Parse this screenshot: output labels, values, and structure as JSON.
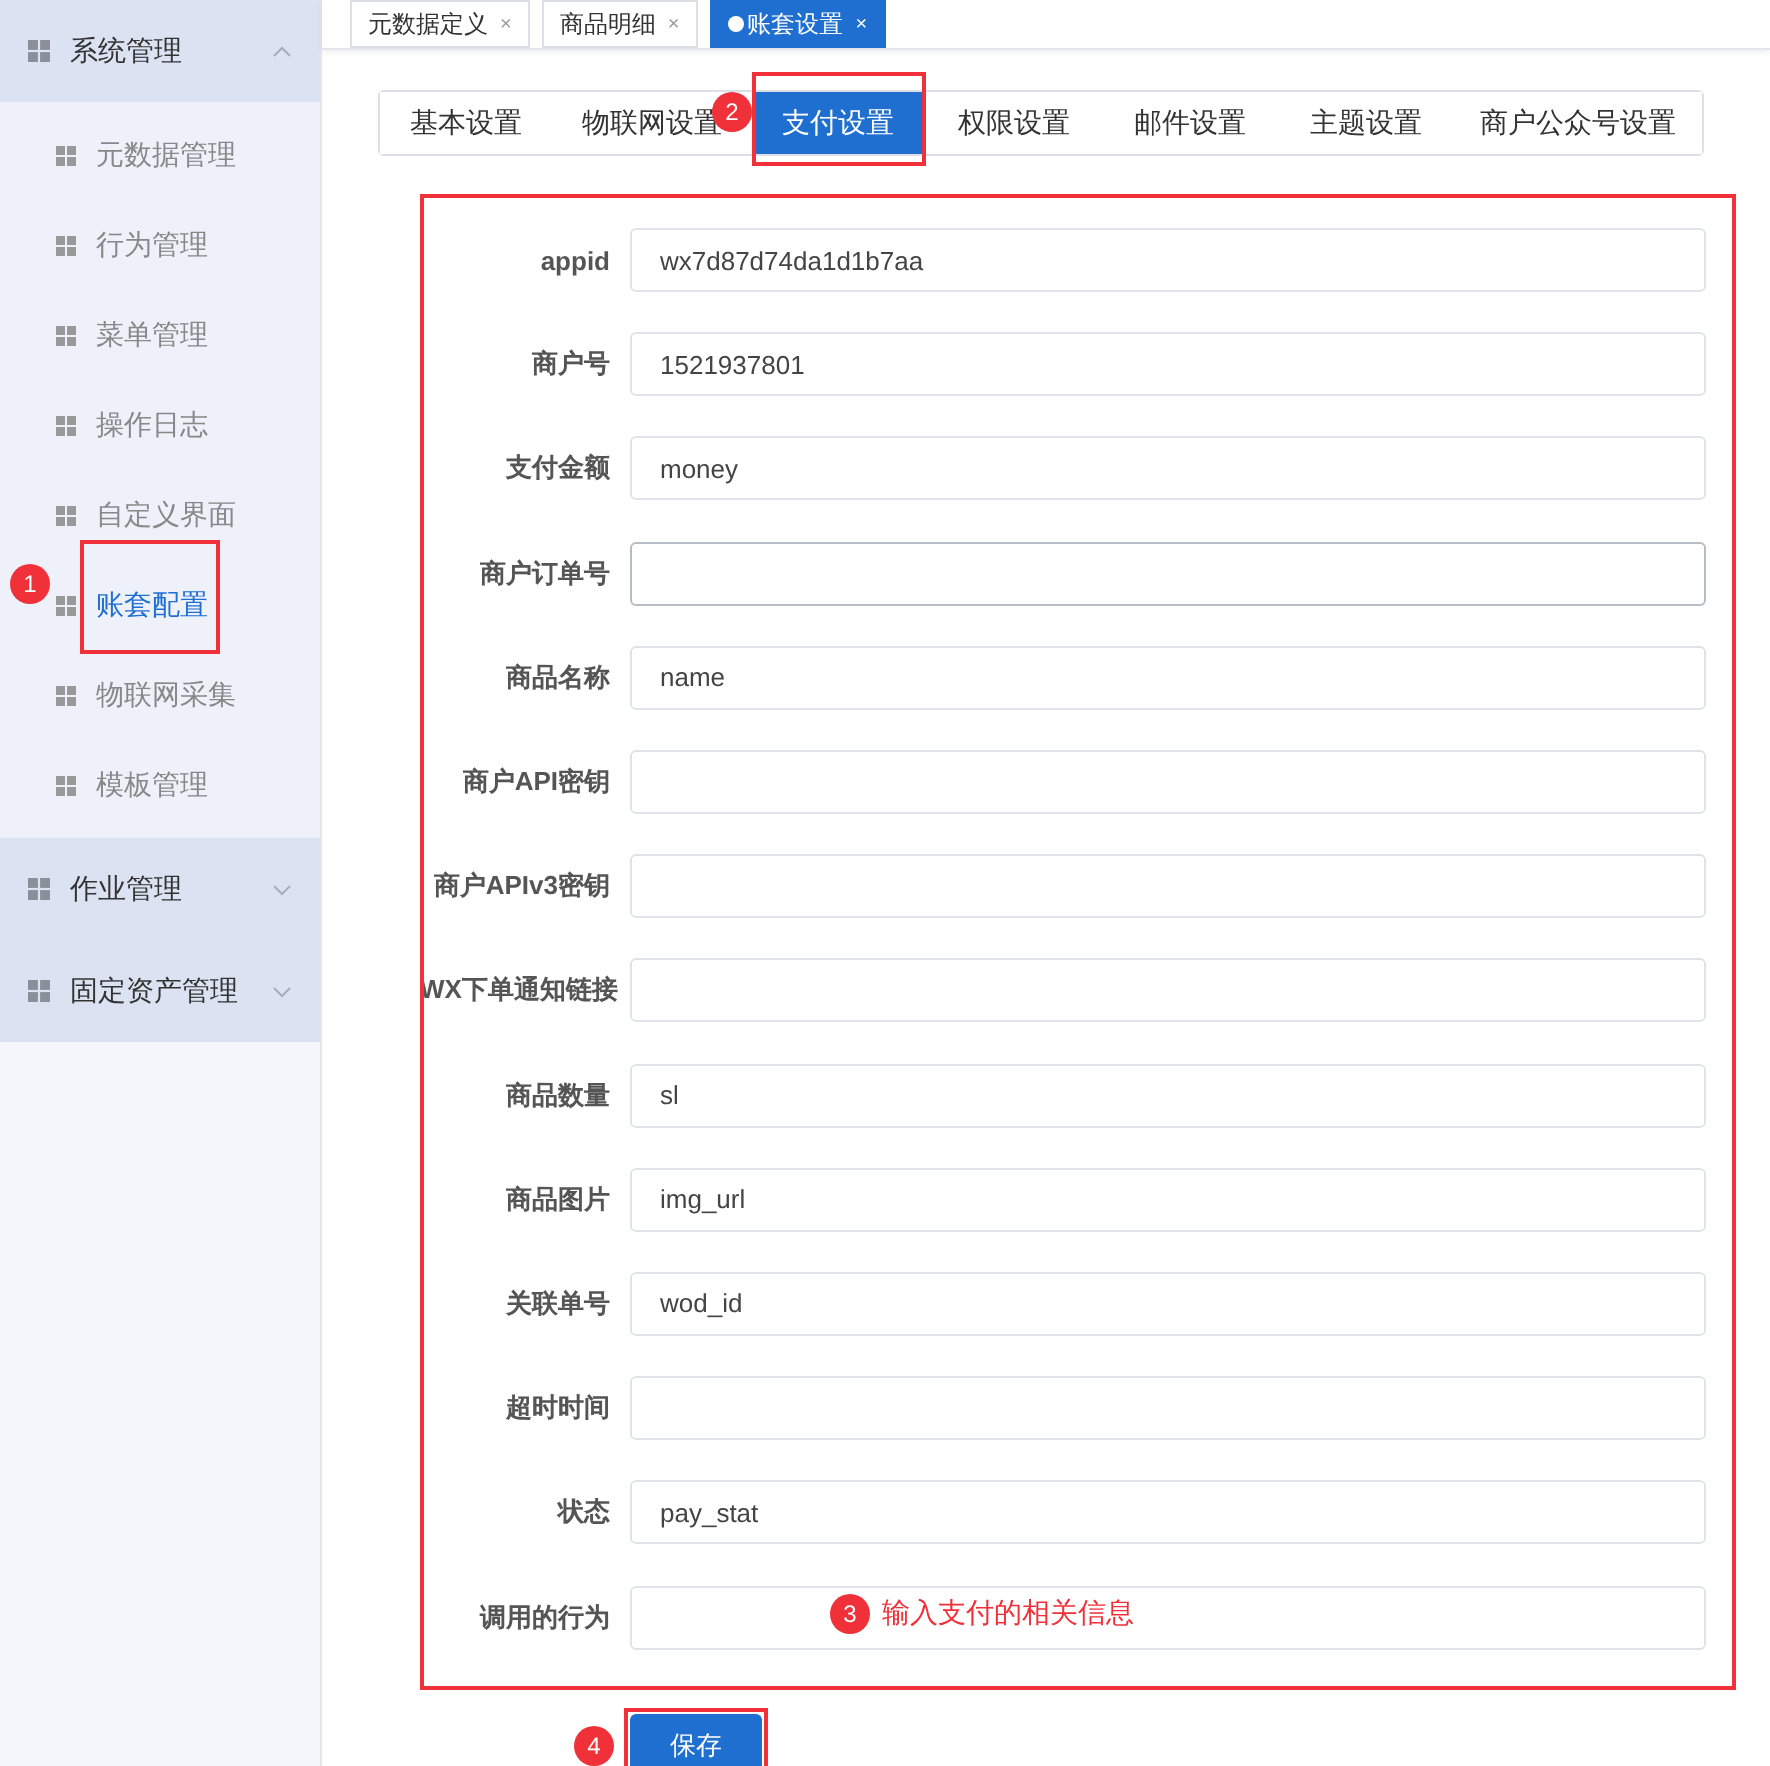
{
  "sidebar": {
    "groups": [
      {
        "label": "系统管理",
        "expanded": true,
        "children": [
          {
            "label": "元数据管理",
            "selected": false
          },
          {
            "label": "行为管理",
            "selected": false
          },
          {
            "label": "菜单管理",
            "selected": false
          },
          {
            "label": "操作日志",
            "selected": false
          },
          {
            "label": "自定义界面",
            "selected": false
          },
          {
            "label": "账套配置",
            "selected": true,
            "annotation": "1"
          },
          {
            "label": "物联网采集",
            "selected": false
          },
          {
            "label": "模板管理",
            "selected": false
          }
        ]
      },
      {
        "label": "作业管理",
        "expanded": false
      },
      {
        "label": "固定资产管理",
        "expanded": false
      }
    ]
  },
  "page_tabs": [
    {
      "label": "元数据定义",
      "selected": false,
      "close": "×"
    },
    {
      "label": "商品明细",
      "selected": false,
      "close": "×"
    },
    {
      "label": "账套设置",
      "selected": true,
      "close": "×"
    }
  ],
  "settings_tabs": [
    {
      "label": "基本设置",
      "selected": false
    },
    {
      "label": "物联网设置",
      "selected": false
    },
    {
      "label": "支付设置",
      "selected": true,
      "annotation": "2"
    },
    {
      "label": "权限设置",
      "selected": false
    },
    {
      "label": "邮件设置",
      "selected": false
    },
    {
      "label": "主题设置",
      "selected": false
    },
    {
      "label": "商户公众号设置",
      "selected": false
    }
  ],
  "form": {
    "annotation": {
      "number": "3",
      "text": "输入支付的相关信息"
    },
    "fields": [
      {
        "label": "appid",
        "value": "wx7d87d74da1d1b7aa"
      },
      {
        "label": "商户号",
        "value": "1521937801"
      },
      {
        "label": "支付金额",
        "value": "money"
      },
      {
        "label": "商户订单号",
        "focused": true
      },
      {
        "label": "商品名称",
        "value": "name"
      },
      {
        "label": "商户API密钥"
      },
      {
        "label": "商户APIv3密钥"
      },
      {
        "label": "WX下单通知链接"
      },
      {
        "label": "商品数量",
        "value": "sl"
      },
      {
        "label": "商品图片",
        "value": "img_url"
      },
      {
        "label": "关联单号",
        "value": "wod_id"
      },
      {
        "label": "超时时间"
      },
      {
        "label": "状态",
        "value": "pay_stat"
      },
      {
        "label": "调用的行为"
      }
    ]
  },
  "save_button": {
    "label": "保存",
    "annotation": "4"
  }
}
